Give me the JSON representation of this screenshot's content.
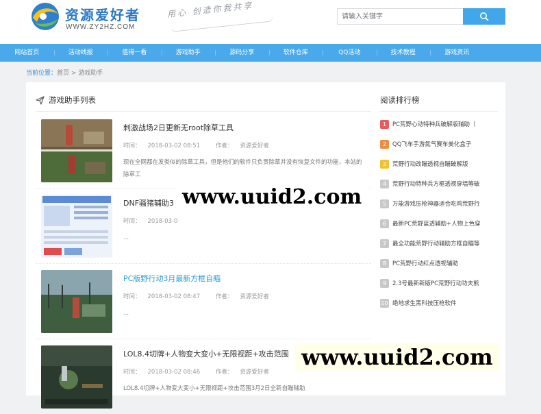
{
  "header": {
    "logo_title": "资源爱好者",
    "logo_domain": "WWW.ZY2HZ.COM",
    "slogan": "用心 创造你我共享",
    "search_placeholder": "请输入关键字"
  },
  "nav": {
    "items": [
      "网站首页",
      "活动线报",
      "值得一看",
      "游戏助手",
      "源码分享",
      "软件仓库",
      "QQ活动",
      "技术教程",
      "游戏资讯"
    ]
  },
  "breadcrumb": {
    "label": "当前位置：",
    "home": "首页",
    "sep": ">",
    "current": "游戏助手"
  },
  "list": {
    "title": "游戏助手列表",
    "time_label": "时间：",
    "author_label": "作者：",
    "articles": [
      {
        "title": "刺激战场2日更新无root除草工具",
        "time": "2018-03-02 08:51",
        "author": "资源爱好者",
        "desc": "现在全网都在发类似的除草工具，但是他们的软件只负责除草并没有恢复文件的功能，本站的除草工",
        "color": "dark"
      },
      {
        "title": "DNF骚猪辅助3",
        "time": "2018-03-0",
        "author": "",
        "desc": "...",
        "color": "dark"
      },
      {
        "title": "PC版野行动3月最新方框自瞄",
        "time": "2018-03-02 08:47",
        "author": "资源爱好者",
        "desc": "...",
        "color": "blue"
      },
      {
        "title": "LOL8.4切牌+人物变大变小+无限视距+攻击范围",
        "time": "2018-03-02 08:46",
        "author": "资源爱好者",
        "desc": "LOL8.4切牌+人物变大变小+无限视距+攻击范围3月2日全新自瞄辅助",
        "color": "dark"
      }
    ]
  },
  "ranking": {
    "title": "阅读排行榜",
    "items": [
      {
        "num": "1",
        "text": "PC荒野心动特种兵破解版辅助（",
        "color": "#e85c5c"
      },
      {
        "num": "2",
        "text": "QQ飞车手游氮气赛车美化盒子",
        "color": "#f08c3a"
      },
      {
        "num": "3",
        "text": "荒野行动改瞄透视自瞄破解版",
        "color": "#f2c12e"
      },
      {
        "num": "4",
        "text": "荒野行动特种兵方框透视穿墙等破",
        "color": "#c8c8c8"
      },
      {
        "num": "5",
        "text": "万能游戏压枪神器适合吃鸡荒野行",
        "color": "#c8c8c8"
      },
      {
        "num": "6",
        "text": "最新PC荒野蓝透辅助+人物上色穿",
        "color": "#c8c8c8"
      },
      {
        "num": "7",
        "text": "最全功能荒野行动辅助方框自瞄等",
        "color": "#c8c8c8"
      },
      {
        "num": "8",
        "text": "PC荒野行动红点透视辅助",
        "color": "#c8c8c8"
      },
      {
        "num": "9",
        "text": "2.3号最新新版PC荒野行动功夫熊",
        "color": "#c8c8c8"
      },
      {
        "num": "10",
        "text": "绝地求生黑科技压枪软件",
        "color": "#c8c8c8"
      }
    ]
  },
  "watermark": "www.uuid2.com"
}
